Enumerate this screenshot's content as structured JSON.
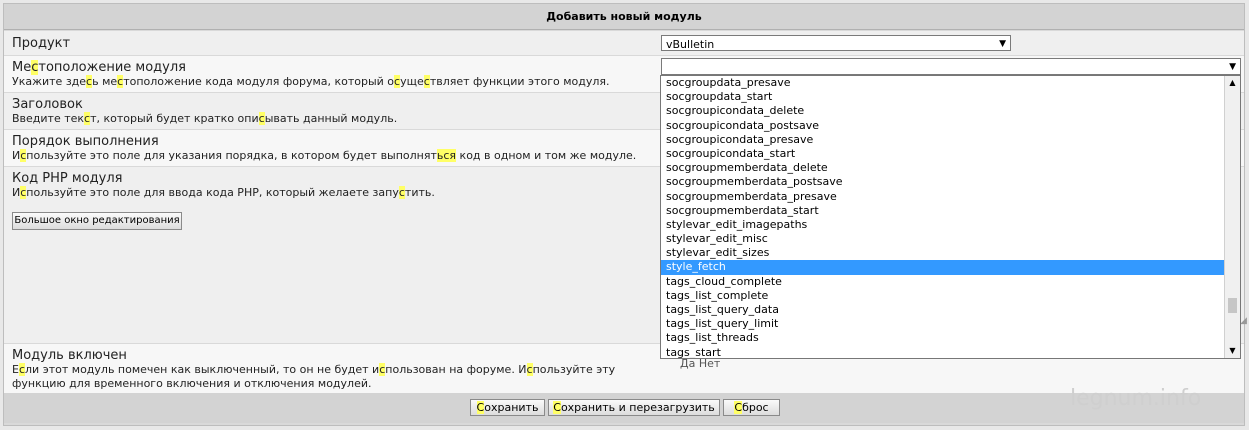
{
  "header": {
    "title": "Добавить новый модуль"
  },
  "product": {
    "label": "Продукт",
    "value": "vBulletin"
  },
  "location": {
    "label_parts": [
      "Ме",
      "с",
      "тоположение модуля"
    ],
    "desc_parts": [
      "Укажите зде",
      "с",
      "ь ме",
      "с",
      "тоположение кода модуля форума, который о",
      "с",
      "уще",
      "с",
      "твляет функции этого модуля."
    ],
    "value": "",
    "options": [
      "socgroupdata_presave",
      "socgroupdata_start",
      "socgroupicondata_delete",
      "socgroupicondata_postsave",
      "socgroupicondata_presave",
      "socgroupicondata_start",
      "socgroupmemberdata_delete",
      "socgroupmemberdata_postsave",
      "socgroupmemberdata_presave",
      "socgroupmemberdata_start",
      "stylevar_edit_imagepaths",
      "stylevar_edit_misc",
      "stylevar_edit_sizes",
      "style_fetch",
      "tags_cloud_complete",
      "tags_list_complete",
      "tags_list_query_data",
      "tags_list_query_limit",
      "tags_list_threads",
      "tags_start"
    ],
    "selected_index": 13
  },
  "title_field": {
    "label": "Заголовок",
    "desc_parts": [
      "Введите тек",
      "с",
      "т, который будет кратко опи",
      "с",
      "ывать данный модуль."
    ]
  },
  "order": {
    "label": "Порядок выполнения",
    "desc_parts": [
      "И",
      "с",
      "пользуйте это поле для указания порядка, в котором будет выполнят",
      "ься",
      " код в одном и том же модуле."
    ]
  },
  "php": {
    "label": "Код PHP модуля",
    "desc_parts": [
      "И",
      "с",
      "пользуйте это поле для ввода кода PHP, который желаете запу",
      "с",
      "тить."
    ],
    "editor_button": "Большое окно редактирования"
  },
  "enabled": {
    "label": "Модуль включен",
    "desc_parts": [
      "Е",
      "с",
      "ли этот модуль помечен как выключенный, то он не будет и",
      "с",
      "пользован на форуме. И",
      "с",
      "пользуйте эту"
    ],
    "desc_line2": "функцию для временного включения и отключения модулей.",
    "partial_text": "Да  Нет"
  },
  "buttons": {
    "save": [
      "С",
      "охранить"
    ],
    "save_reload": [
      "С",
      "охранить и перезагрузить"
    ],
    "reset": [
      "С",
      "брос"
    ]
  },
  "watermark": "legnum.info",
  "icons": {
    "dropdown": "triangle-down-icon",
    "scroll_up": "triangle-up-icon",
    "scroll_down": "triangle-down-icon"
  },
  "colors": {
    "highlight": "#ffff66",
    "selected": "#3399ff"
  }
}
